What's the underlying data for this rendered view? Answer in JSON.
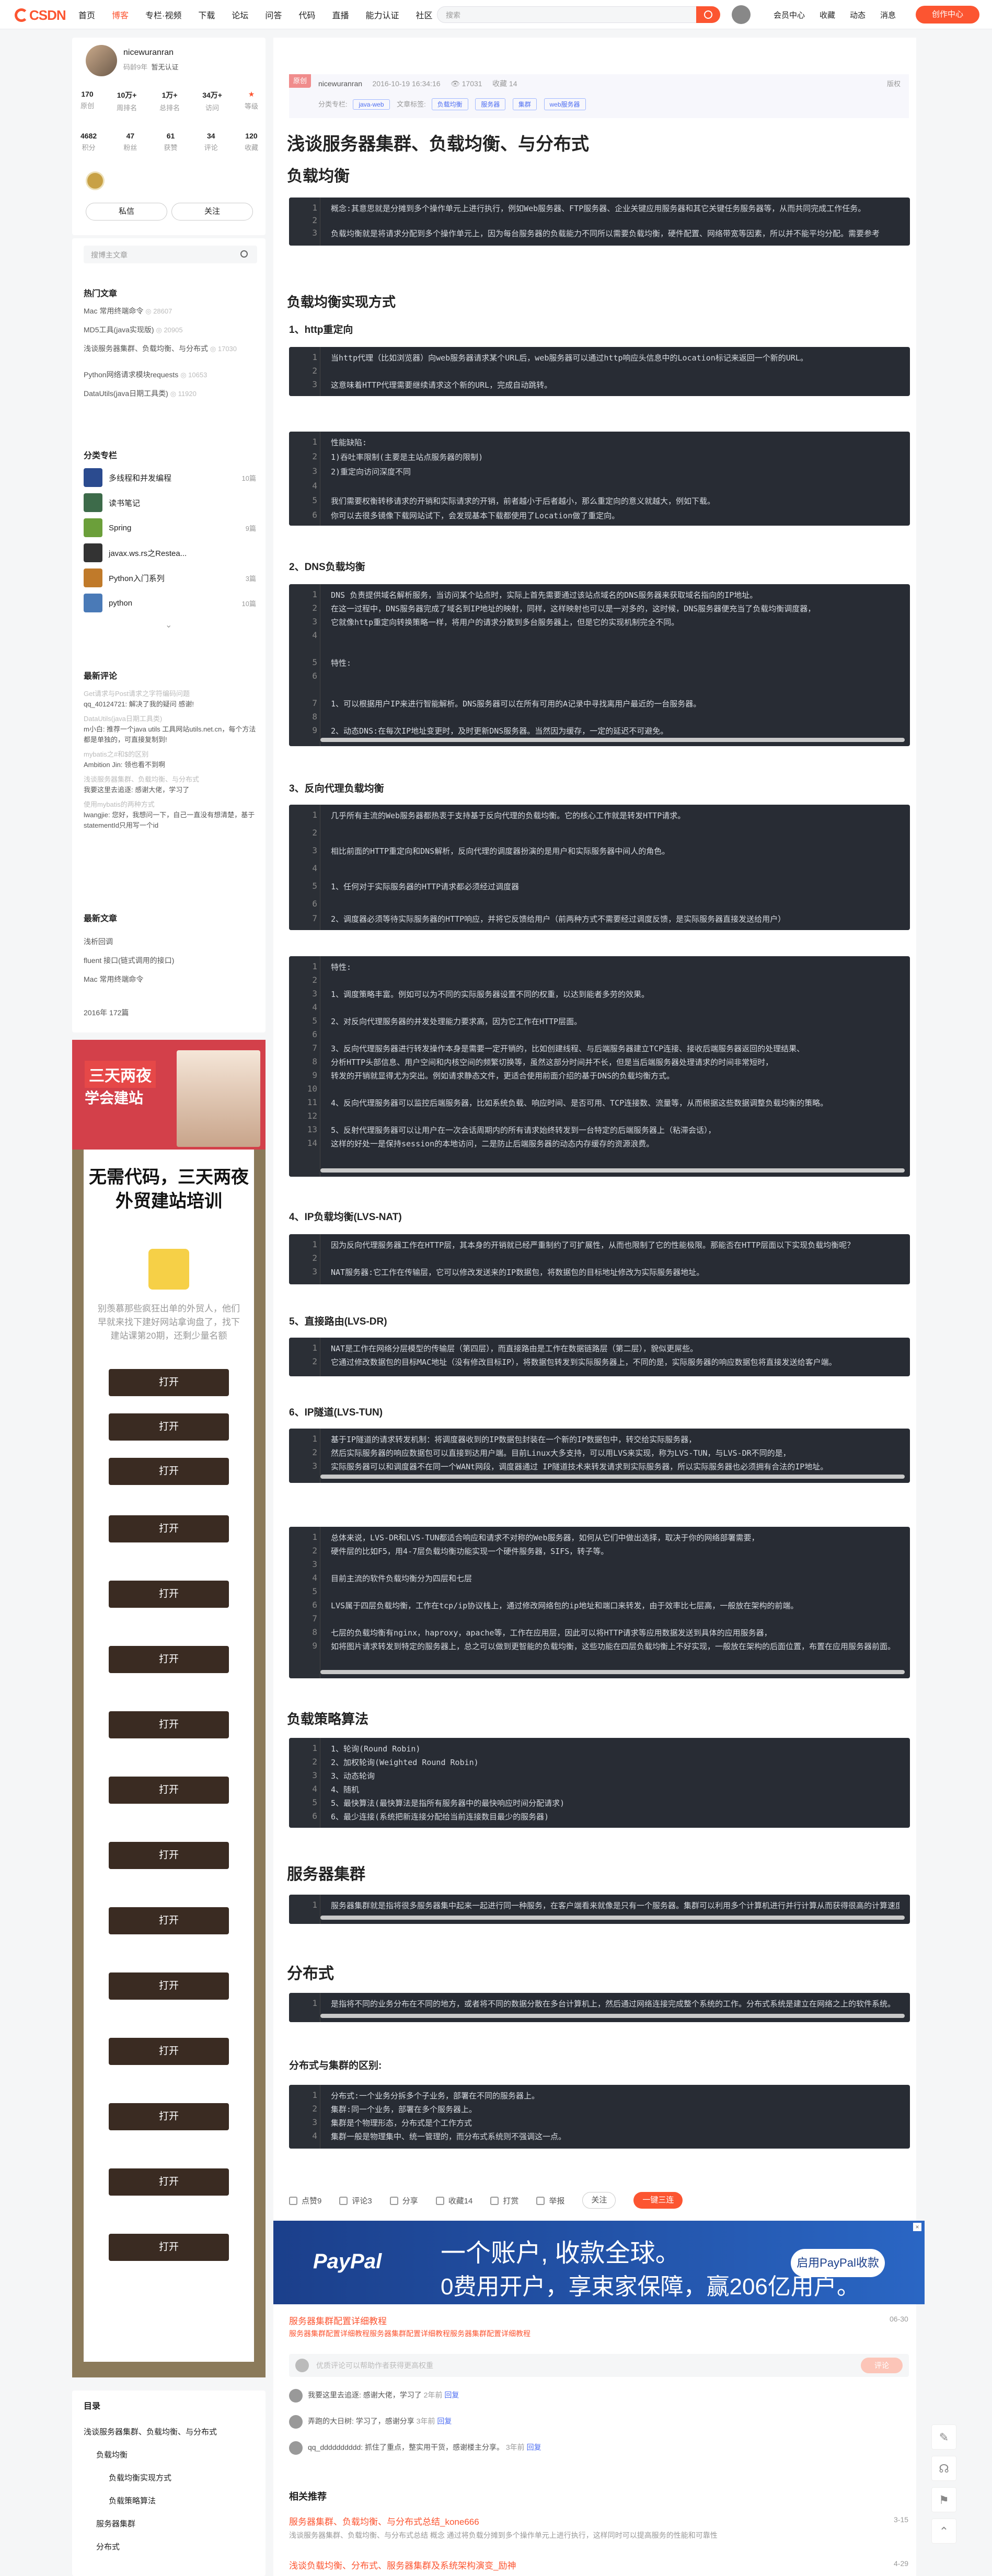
{
  "nav": {
    "logo": "CSDN",
    "items": [
      "首页",
      "博客",
      "专栏·视频",
      "下载",
      "论坛",
      "问答",
      "代码",
      "直播",
      "能力认证",
      "社区"
    ],
    "active_index": 1,
    "search_placeholder": "搜索",
    "right": [
      "会员中心",
      "收藏",
      "动态",
      "消息"
    ],
    "create": "创作中心"
  },
  "author": {
    "name": "nicewuranran",
    "level": "码龄9年",
    "verify": "暂无认证",
    "stats_row1": [
      {
        "v": "170",
        "l": "原创"
      },
      {
        "v": "10万+",
        "l": "周排名"
      },
      {
        "v": "1万+",
        "l": "总排名"
      },
      {
        "v": "34万+",
        "l": "访问"
      },
      {
        "v": "",
        "l": "等级"
      }
    ],
    "stats_row2": [
      {
        "v": "4682",
        "l": "积分"
      },
      {
        "v": "47",
        "l": "粉丝"
      },
      {
        "v": "61",
        "l": "获赞"
      },
      {
        "v": "34",
        "l": "评论"
      },
      {
        "v": "120",
        "l": "收藏"
      }
    ],
    "btn_msg": "私信",
    "btn_follow": "关注"
  },
  "sidebar": {
    "search_placeholder": "搜博主文章",
    "hot_title": "热门文章",
    "hot": [
      {
        "t": "Mac 常用终端命令",
        "n": "28607"
      },
      {
        "t": "MD5工具(java实现版)",
        "n": "20905"
      },
      {
        "t": "浅谈服务器集群、负载均衡、与分布式",
        "n": "17030"
      },
      {
        "t": "Python网络请求模块requests",
        "n": "10653"
      },
      {
        "t": "DataUtils(java日期工具类)",
        "n": "11920"
      }
    ],
    "col_title": "分类专栏",
    "columns": [
      {
        "t": "多线程和并发编程",
        "n": "10篇",
        "c": "#2b4b8f"
      },
      {
        "t": "读书笔记",
        "n": "",
        "c": "#3d6b4a"
      },
      {
        "t": "Spring",
        "n": "9篇",
        "c": "#6b9f3a"
      },
      {
        "t": "javax.ws.rs之Restea...",
        "n": "",
        "c": "#333"
      },
      {
        "t": "Python入门系列",
        "n": "3篇",
        "c": "#c07a2a"
      },
      {
        "t": "python",
        "n": "10篇",
        "c": "#4a7ab7"
      }
    ],
    "comments_title": "最新评论",
    "comments": [
      {
        "q": "Get请求与Post请求之字符编码问题",
        "a": "qq_40124721: 解决了我的疑问 感谢!"
      },
      {
        "q": "DataUtils(java日期工具类)",
        "a": "m小白: 推荐一个java utils 工具网站utils.net.cn，每个方法都是单独的，可直接复制到!"
      },
      {
        "q": "mybatis之#和$的区别",
        "a": "Ambition Jin: 领也看不到啊"
      },
      {
        "q": "浅谈服务器集群、负载均衡、与分布式",
        "a": "我要这里去追逐: 感谢大佬，学习了"
      },
      {
        "q": "使用mybatis的两种方式",
        "a": "lwangjie: 您好，我想问一下，自己一直没有想清楚，基于statementId只用写一个id"
      }
    ],
    "recent_title": "最新文章",
    "recent": [
      "浅析回调",
      "fluent 接口(链式调用的接口)",
      "Mac 常用终端命令"
    ],
    "archive": "2016年 172篇"
  },
  "ad_left": {
    "top1": "三天两夜",
    "top2": "学会建站",
    "headline": "无需代码，三天两夜外贸建站培训",
    "desc": "别羡慕那些疯狂出单的外贸人，他们早就来找下建好网站拿询盘了，找下建站课第20期，还剩少量名额",
    "button": "打开",
    "button_count": 15
  },
  "toc": {
    "title": "目录",
    "items": [
      "浅谈服务器集群、负载均衡、与分布式",
      "负载均衡",
      "负载均衡实现方式",
      "负载策略算法",
      "服务器集群",
      "分布式"
    ]
  },
  "article": {
    "original": "原创",
    "author": "nicewuranran",
    "date": "2016-10-19 16:34:16",
    "views": "17031",
    "fav": "收藏 14",
    "edit": "版权",
    "col_label": "分类专栏:",
    "col_tags": [
      "java-web"
    ],
    "tag_label": "文章标签:",
    "tags": [
      "负载均衡",
      "服务器",
      "集群",
      "web服务器"
    ],
    "title": "浅谈服务器集群、负载均衡、与分布式",
    "h_load": "负载均衡",
    "code1": [
      "概念:其意思就是分摊到多个操作单元上进行执行，例如Web服务器、FTP服务器、企业关键应用服务器和其它关键任务服务器等，从而共同完成工作任务。",
      "",
      "负载均衡就是将请求分配到多个操作单元上，因为每台服务器的负载能力不同所以需要负载均衡，硬件配置、网络带宽等因素，所以并不能平均分配。需要参考"
    ],
    "h_impl": "负载均衡实现方式",
    "h_http": "1、http重定向",
    "code2": [
      "当http代理（比如浏览器）向web服务器请求某个URL后，web服务器可以通过http响应头信息中的Location标记来返回一个新的URL。",
      "",
      "这意味着HTTP代理需要继续请求这个新的URL，完成自动跳转。"
    ],
    "code3": [
      "性能缺陷:",
      "1)吞吐率限制(主要是主站点服务器的限制)",
      "2)重定向访问深度不同",
      "",
      "我们需要权衡转移请求的开销和实际请求的开销，前者越小于后者越小，那么重定向的意义就越大，例如下载。",
      "你可以去很多镜像下载网站试下，会发现基本下载都使用了Location做了重定向。"
    ],
    "h_dns": "2、DNS负载均衡",
    "code4": [
      "DNS 负责提供域名解析服务，当访问某个站点时，实际上首先需要通过该站点域名的DNS服务器来获取域名指向的IP地址。",
      "在这一过程中，DNS服务器完成了域名到IP地址的映射，同样，这样映射也可以是一对多的，这时候，DNS服务器便充当了负载均衡调度器，",
      "它就像http重定向转换策略一样，将用户的请求分散到多台服务器上，但是它的实现机制完全不同。",
      "",
      "特性:",
      "",
      "1、可以根据用户IP来进行智能解析。DNS服务器可以在所有可用的A记录中寻找离用户最近的一台服务器。",
      "",
      "2、动态DNS:在每次IP地址变更时，及时更新DNS服务器。当然因为缓存，一定的延迟不可避免。"
    ],
    "h_proxy": "3、反向代理负载均衡",
    "code5": [
      "几乎所有主流的Web服务器都热衷于支持基于反向代理的负载均衡。它的核心工作就是转发HTTP请求。",
      "",
      "相比前面的HTTP重定向和DNS解析，反向代理的调度器扮演的是用户和实际服务器中间人的角色。",
      "",
      "1、任何对于实际服务器的HTTP请求都必须经过调度器",
      "",
      "2、调度器必须等待实际服务器的HTTP响应，并将它反馈给用户（前两种方式不需要经过调度反馈，是实际服务器直接发送给用户）"
    ],
    "code6": [
      "特性:",
      "",
      "1、调度策略丰富。例如可以为不同的实际服务器设置不同的权重，以达到能者多劳的效果。",
      "",
      "2、对反向代理服务器的并发处理能力要求高，因为它工作在HTTP层面。",
      "",
      "3、反向代理服务器进行转发操作本身是需要一定开销的，比如创建线程、与后端服务器建立TCP连接、接收后端服务器返回的处理结果、",
      "分析HTTP头部信息、用户空间和内核空间的频繁切换等，虽然这部分时间并不长，但是当后端服务器处理请求的时间非常短时，",
      "转发的开销就显得尤为突出。例如请求静态文件，更适合使用前面介绍的基于DNS的负载均衡方式。",
      "",
      "4、反向代理服务器可以监控后端服务器，比如系统负载、响应时间、是否可用、TCP连接数、流量等，从而根据这些数据调整负载均衡的策略。",
      "",
      "5、反射代理服务器可以让用户在一次会话周期内的所有请求始终转发到一台特定的后端服务器上（粘滞会话），",
      "这样的好处一是保持session的本地访问，二是防止后端服务器的动态内存缓存的资源浪费。"
    ],
    "h_nat": "4、IP负载均衡(LVS-NAT)",
    "code7": [
      "因为反向代理服务器工作在HTTP层，其本身的开销就已经严重制约了可扩展性，从而也限制了它的性能极限。那能否在HTTP层面以下实现负载均衡呢？",
      "",
      "NAT服务器:它工作在传输层，它可以修改发送来的IP数据包，将数据包的目标地址修改为实际服务器地址。"
    ],
    "h_dr": "5、直接路由(LVS-DR)",
    "code8": [
      "NAT是工作在网络分层模型的传输层（第四层），而直接路由是工作在数据链路层（第二层），貌似更屌些。",
      "它通过修改数据包的目标MAC地址（没有修改目标IP），将数据包转发到实际服务器上，不同的是，实际服务器的响应数据包将直接发送给客户端。"
    ],
    "h_tun": "6、IP隧道(LVS-TUN)",
    "code9": [
      "基于IP隧道的请求转发机制：将调度器收到的IP数据包封装在一个新的IP数据包中，转交给实际服务器，",
      "然后实际服务器的响应数据包可以直接到达用户端。目前Linux大多支持，可以用LVS来实现，称为LVS-TUN，与LVS-DR不同的是，",
      "实际服务器可以和调度器不在同一个WANt网段，调度器通过 IP隧道技术来转发请求到实际服务器，所以实际服务器也必须拥有合法的IP地址。"
    ],
    "code10": [
      "总体来说，LVS-DR和LVS-TUN都适合响应和请求不对称的Web服务器，如何从它们中做出选择，取决于你的网络部署需要，",
      "硬件层的比如F5，用4-7层负载均衡功能实现一个硬件服务器，SIFS，转子等。",
      "",
      "目前主流的软件负载均衡分为四层和七层",
      "",
      "LVS属于四层负载均衡，工作在tcp/ip协议栈上，通过修改网络包的ip地址和端口来转发，由于效率比七层高，一般放在架构的前端。",
      "",
      "七层的负载均衡有nginx，haproxy，apache等，工作在应用层，因此可以将HTTP请求等应用数据发送到具体的应用服务器，",
      "如将图片请求转发到特定的服务器上，总之可以做到更智能的负载均衡，这些功能在四层负载均衡上不好实现，一般放在架构的后面位置，布置在应用服务器前面。"
    ],
    "h_algo": "负载策略算法",
    "code11": [
      "1、轮询(Round Robin)",
      "2、加权轮询(Weighted Round Robin)",
      "3、动态轮询",
      "4、随机",
      "5、最快算法(最快算法是指所有服务器中的最快响应时间分配请求)",
      "6、最少连接(系统把新连接分配给当前连接数目最少的服务器)"
    ],
    "h_cluster": "服务器集群",
    "code12": [
      "服务器集群就是指将很多服务器集中起来一起进行同一种服务，在客户端看来就像是只有一个服务器。集群可以利用多个计算机进行并行计算从而获得很高的计算速度，"
    ],
    "h_dist": "分布式",
    "code13": [
      "是指将不同的业务分布在不同的地方，或者将不同的数据分散在多台计算机上，然后通过网络连接完成整个系统的工作。分布式系统是建立在网络之上的软件系统。"
    ],
    "h_diff": "分布式与集群的区别:",
    "code14": [
      "分布式:一个业务分拆多个子业务，部署在不同的服务器上。",
      "集群:同一个业务，部署在多个服务器上。",
      "集群是个物理形态，分布式是个工作方式",
      "集群一般是物理集中、统一管理的，而分布式系统则不强调这一点。"
    ]
  },
  "actions": {
    "like": "点赞9",
    "comment": "评论3",
    "share": "分享",
    "fav": "收藏14",
    "reward": "打赏",
    "report": "举报",
    "follow": "关注",
    "onekey": "一键三连"
  },
  "paypal": {
    "logo": "PayPal",
    "line1": "一个账户, 收款全球。",
    "line2": "0费用开户，享束家保障，赢206亿用户。",
    "button": "启用PayPal收款"
  },
  "related_top": {
    "link": "服务器集群配置详细教程",
    "date": "06-30",
    "sub": "服务器集群配置详细教程服务器集群配置详细教程服务器集群配置详细教程"
  },
  "comments": {
    "placeholder": "优质评论可以帮助作者获得更高权重",
    "submit": "评论",
    "list": [
      {
        "u": "我要这里去追逐:",
        "t": "感谢大佬，学习了",
        "time": "2年前",
        "r": "回复"
      },
      {
        "u": "弄跑的大日树:",
        "t": "学习了，感谢分享",
        "time": "3年前",
        "r": "回复"
      },
      {
        "u": "qq_dddddddddd:",
        "t": "抓住了重点，整实用干货，感谢楼主分享。",
        "time": "3年前",
        "r": "回复"
      }
    ]
  },
  "recommend": {
    "title": "相关推荐",
    "items": [
      {
        "t": "服务器集群、负载均衡、与分布式总结_kone666",
        "d": "3-15",
        "s": "浅谈服务器集群、负载均衡、与分布式总结 概念 通过将负载分摊到多个操作单元上进行执行，这样同时可以提高服务的性能和可靠性"
      },
      {
        "t": "浅谈负载均衡、分布式、服务器集群及系统架构演变_励神",
        "d": "4-29",
        "s": ""
      }
    ]
  }
}
